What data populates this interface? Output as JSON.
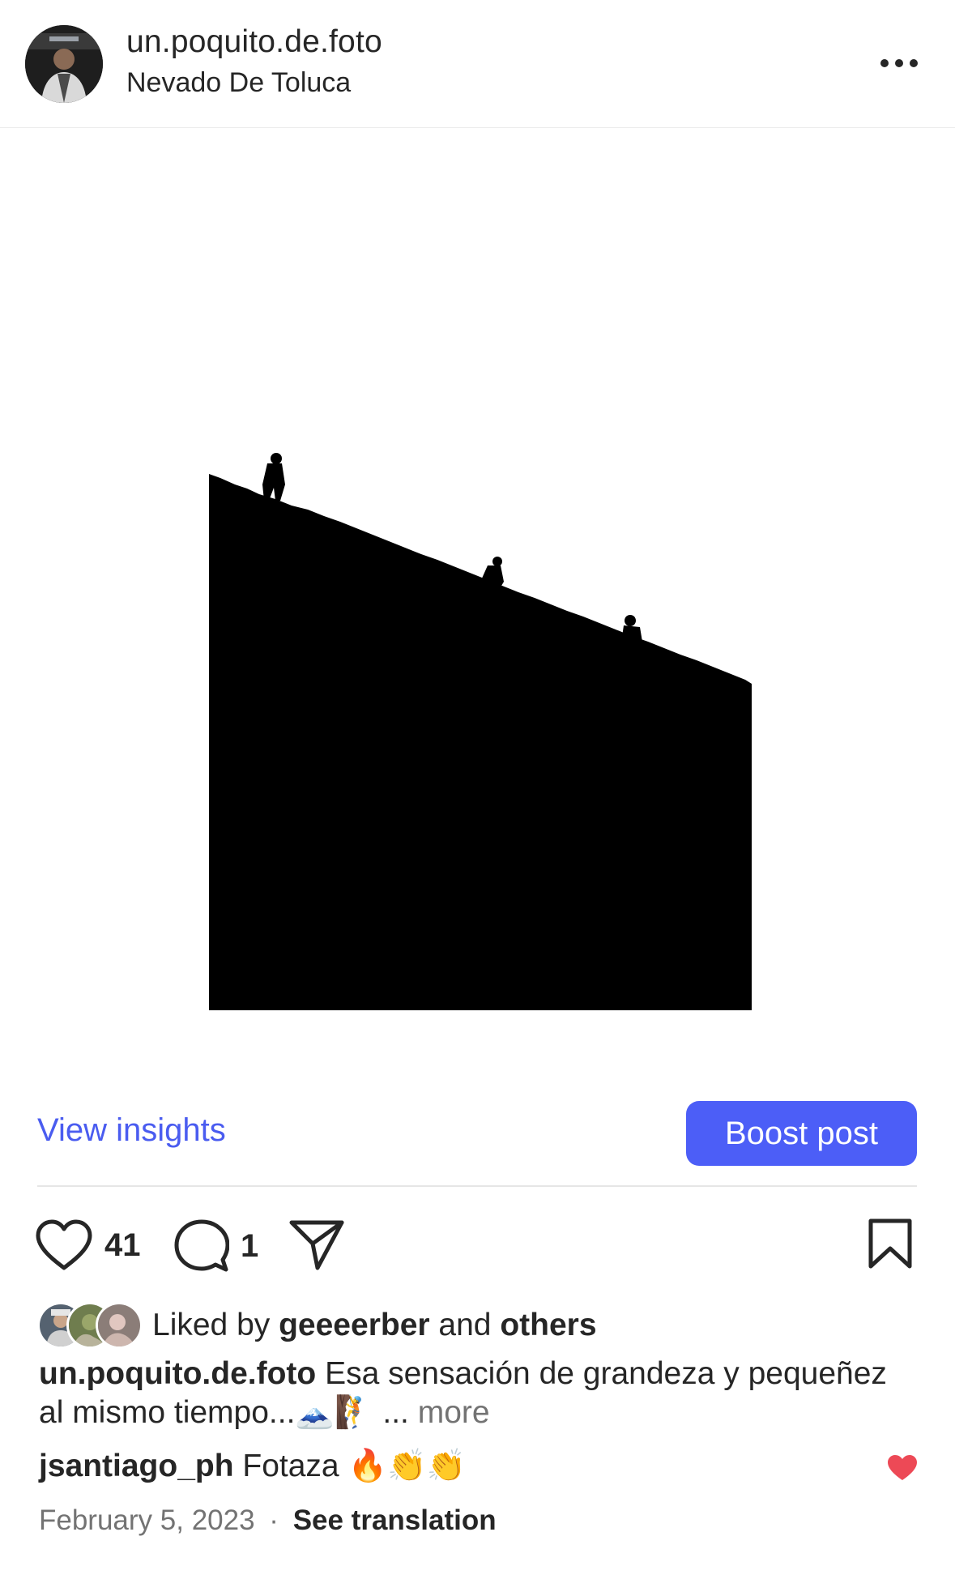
{
  "post": {
    "username": "un.poquito.de.foto",
    "location": "Nevado De Toluca",
    "more_icon": "more-horizontal-icon"
  },
  "insights": {
    "view_label": "View insights",
    "boost_label": "Boost post",
    "accent_color": "#4c5ef7"
  },
  "actions": {
    "like_count": "41",
    "comment_count": "1",
    "icons": [
      "heart-icon",
      "comment-icon",
      "share-icon",
      "bookmark-icon"
    ]
  },
  "likes": {
    "prefix": "Liked by",
    "user": "geeeerber",
    "and": "and",
    "others": "others"
  },
  "caption": {
    "username": "un.poquito.de.foto",
    "text": "Esa sensación de grandeza y pequeñez al mismo tiempo...🗻🧗",
    "ellipsis": "...",
    "more": "more"
  },
  "comment": {
    "username": "jsantiago_ph",
    "text": "Fotaza 🔥👏👏",
    "liked_color": "#ed4956"
  },
  "meta": {
    "date": "February 5, 2023",
    "separator": "·",
    "see_translation": "See translation"
  }
}
